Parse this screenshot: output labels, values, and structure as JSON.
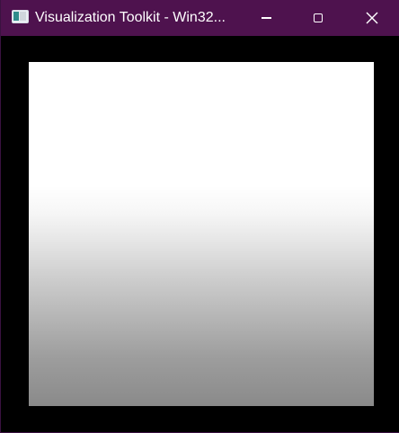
{
  "window": {
    "title": "Visualization Toolkit - Win32...",
    "icon": "vtk-app-icon",
    "titlebar_color": "#4e124e",
    "controls": {
      "minimize_icon": "minimize-icon",
      "maximize_icon": "maximize-icon",
      "close_icon": "close-icon",
      "close_glyph": "✕"
    }
  },
  "render_view": {
    "background_color": "#000000",
    "gradient_top_color": "#ffffff",
    "gradient_bottom_color": "#8a8a8a"
  }
}
